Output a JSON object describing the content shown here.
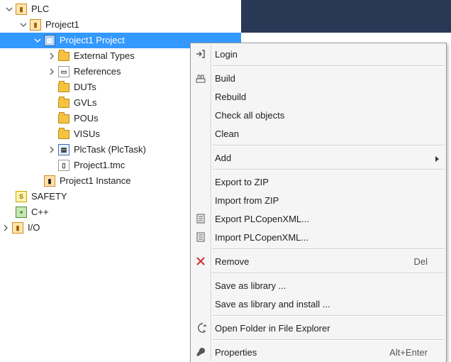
{
  "tree": {
    "plc": "PLC",
    "project1": "Project1",
    "project1_project": "Project1 Project",
    "external_types": "External Types",
    "references": "References",
    "duts": "DUTs",
    "gvls": "GVLs",
    "pous": "POUs",
    "visus": "VISUs",
    "plctask": "PlcTask (PlcTask)",
    "tmc": "Project1.tmc",
    "instance": "Project1 Instance",
    "safety": "SAFETY",
    "cpp": "C++",
    "io": "I/O"
  },
  "menu": {
    "login": "Login",
    "build": "Build",
    "rebuild": "Rebuild",
    "check_all": "Check all objects",
    "clean": "Clean",
    "add": "Add",
    "export_zip": "Export to ZIP",
    "import_zip": "Import from ZIP",
    "export_xml": "Export PLCopenXML...",
    "import_xml": "Import PLCopenXML...",
    "remove": "Remove",
    "remove_shortcut": "Del",
    "save_lib": "Save as library ...",
    "save_lib_install": "Save as library and install ...",
    "open_folder": "Open Folder in File Explorer",
    "properties": "Properties",
    "properties_shortcut": "Alt+Enter"
  }
}
